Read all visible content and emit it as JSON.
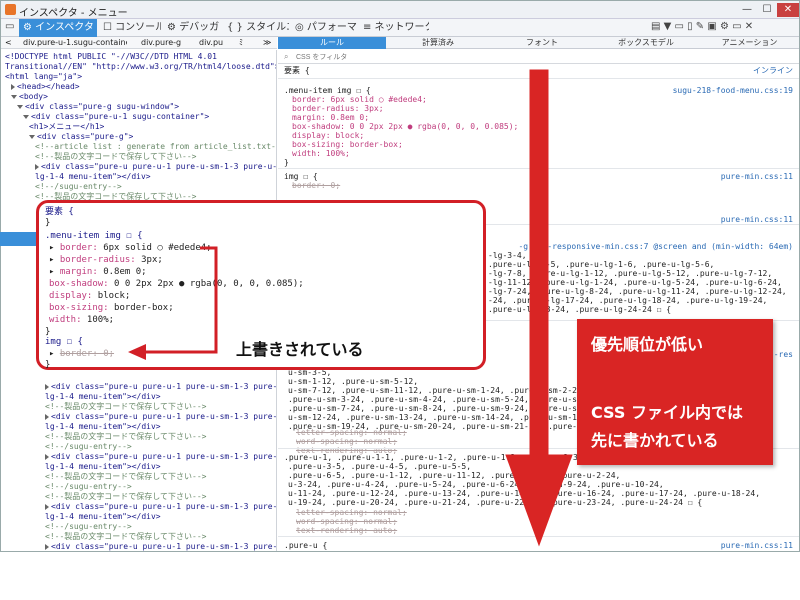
{
  "window": {
    "title": "インスペクタ - メニュー",
    "min": "—",
    "max": "☐",
    "close": "✕"
  },
  "toolbar": {
    "tabs": [
      {
        "label": "⚙ インスペクタ",
        "active": true
      },
      {
        "label": "☐ コンソール"
      },
      {
        "label": "⚙ デバッガ"
      },
      {
        "label": "{ } スタイルエ…"
      },
      {
        "label": "◎ パフォーマ…"
      },
      {
        "label": "≡ ネットワーク"
      }
    ],
    "right_icons": "▤ ▼  ▭ ▯  ✎ ▣  ⚙ ▭ ✕"
  },
  "breadcrumb": {
    "back": "<",
    "items": [
      "div.pure-u-1.sugu-container",
      "div.pure-g",
      "div.pu"
    ],
    "more": "≫",
    "more_left": "ﾐ"
  },
  "markup": {
    "lines": [
      {
        "text": "<!DOCTYPE html PUBLIC \"-//W3C//DTD HTML 4.01",
        "indent": 0
      },
      {
        "text": "Transitional//EN\" \"http://www.w3.org/TR/html4/loose.dtd\">",
        "indent": 0
      },
      {
        "text": "<html lang=\"ja\">",
        "indent": 0
      },
      {
        "text": "<head></head>",
        "indent": 1,
        "tri": "r"
      },
      {
        "text": "<body>",
        "indent": 1,
        "tri": "d"
      },
      {
        "text": "<div class=\"pure-g sugu-window\">",
        "indent": 2,
        "tri": "d"
      },
      {
        "text": "<div class=\"pure-u-1 sugu-container\">",
        "indent": 3,
        "tri": "d"
      },
      {
        "text": "<h1>メニュー</h1>",
        "indent": 4
      },
      {
        "text": "<div class=\"pure-g\">",
        "indent": 4,
        "tri": "d"
      },
      {
        "text": "<!--article list : generate from article_list.txt-->",
        "indent": 5,
        "cm": true
      },
      {
        "text": "<!--製品の文字コードで保存して下さい-->",
        "indent": 5,
        "cm": true
      },
      {
        "text": "<div class=\"pure-u pure-u-1 pure-u-sm-1-3 pure-u-",
        "indent": 5,
        "tri": "r"
      },
      {
        "text": "lg-1-4 menu-item\"></div>",
        "indent": 5
      },
      {
        "text": "<!--/sugu-entry-->",
        "indent": 5,
        "cm": true
      },
      {
        "text": "<!--製品の文字コードで保存して下さい-->",
        "indent": 5,
        "cm": true
      }
    ],
    "lines2": [
      {
        "text": "<div class=\"pure-u pure-u-1 pure-u-sm-1-3 pure-u-",
        "tri": "r"
      },
      {
        "text": "lg-1-4 menu-item\"></div>"
      },
      {
        "text": "<!--製品の文字コードで保存して下さい-->",
        "cm": true
      },
      {
        "text": "<div class=\"pure-u pure-u-1 pure-u-sm-1-3 pure-u-",
        "tri": "r"
      },
      {
        "text": "lg-1-4 menu-item\"></div>"
      },
      {
        "text": "<!--製品の文字コードで保存して下さい-->",
        "cm": true
      },
      {
        "text": "<!--/sugu-entry-->",
        "cm": true
      },
      {
        "text": "<div class=\"pure-u pure-u-1 pure-u-sm-1-3 pure-u-",
        "tri": "r"
      },
      {
        "text": "lg-1-4 menu-item\"></div>"
      },
      {
        "text": "<!--製品の文字コードで保存して下さい-->",
        "cm": true
      },
      {
        "text": "<!--/sugu-entry-->",
        "cm": true
      },
      {
        "text": "<!--製品の文字コードで保存して下さい-->",
        "cm": true
      },
      {
        "text": "<div class=\"pure-u pure-u-1 pure-u-sm-1-3 pure-u-",
        "tri": "r"
      },
      {
        "text": "lg-1-4 menu-item\"></div>"
      },
      {
        "text": "<!--/sugu-entry-->",
        "cm": true
      },
      {
        "text": "<!--製品の文字コードで保存して下さい-->",
        "cm": true
      },
      {
        "text": "<div class=\"pure-u pure-u-1 pure-u-sm-1-3 pure-u-",
        "tri": "r"
      },
      {
        "text": "lg-1-4 menu-item\"></div>"
      },
      {
        "text": "<!--/sugu-entry-->",
        "cm": true
      },
      {
        "text": "<!--製品の文字コードで保存して下さい-->",
        "cm": true
      }
    ]
  },
  "rule_tabs": [
    "ルール",
    "計算済み",
    "フォント",
    "ボックスモデル",
    "アニメーション"
  ],
  "filter": {
    "placeholder": "CSS をフィルタ"
  },
  "rules": {
    "element_selector": "要素 {",
    "element_source": "インライン",
    "menu_item": {
      "selector": ".menu-item img ☐ {",
      "source": "sugu-218-food-menu.css:19",
      "props": [
        "border: 6px solid ○ #edede4;",
        "border-radius: 3px;",
        "margin: 0.8em 0;",
        "box-shadow: 0 0 2px 2px ● rgba(0, 0, 0, 0.085);",
        "display: block;",
        "box-sizing: border-box;",
        "width: 100%;"
      ]
    },
    "img_rule": {
      "selector": "img ☐ {",
      "source": "pure-min.css:11",
      "prop": "border: 0;"
    },
    "mid_source_1": "pure-min.css:11",
    "mid_source_2": "-grids-responsive-min.css:7 @screen and (min-width: 64em)",
    "mid_source_3": "-grids-res",
    "grid_lines_1": [
      "-lg-3-4,",
      ".pure-u-lg-1-5, .pure-u-lg-1-6, .pure-u-lg-5-6,",
      "-lg-7-8, .pure-u-lg-1-12, .pure-u-lg-5-12, .pure-u-lg-7-12,",
      "-lg-11-12, .pure-u-lg-1-24, .pure-u-lg-5-24, .pure-u-lg-6-24,",
      "-lg-7-24, .pure-u-lg-8-24, .pure-u-lg-11-24, .pure-u-lg-12-24,",
      "-24, .pure-u-lg-17-24, .pure-u-lg-18-24, .pure-u-lg-19-24,",
      ".pure-u-lg-23-24, .pure-u-lg-24-24 ☐ {"
    ],
    "grid_lines_2": [
      "u-sm-3-5,",
      "u-sm-1-12, .pure-u-sm-5-12,",
      "u-sm-7-12, .pure-u-sm-11-12, .pure-u-sm-1-24, .pure-u-sm-2-24,",
      ".pure-u-sm-3-24, .pure-u-sm-4-24, .pure-u-sm-5-24, .pure-u-sm-6-24,",
      ".pure-u-sm-7-24, .pure-u-sm-8-24, .pure-u-sm-9-24, .pure-u-sm-10-24,",
      "u-sm-12-24, .pure-u-sm-13-24, .pure-u-sm-14-24, .pure-u-sm-15-24,",
      ".pure-u-sm-19-24, .pure-u-sm-20-24, .pure-u-sm-21-24, .pure-u-sm-22-24 ☐"
    ],
    "strike_props_1": [
      "letter-spacing: normal;",
      "word-spacing: normal;",
      "text-rendering: auto;"
    ],
    "pure_u_1": ".pure-u-1, .pure-u-1-1, .pure-u-1-2, .pure-u-1-3, .pure-u-2-3,",
    "pure_u_lines": [
      ".pure-u-3-5, .pure-u-4-5, .pure-u-5-5,",
      ".pure-u-6-5, .pure-u-1-12, .pure-u-11-12, .pure-u-1-24, .pure-u-2-24,",
      "u-3-24, .pure-u-4-24, .pure-u-5-24, .pure-u-6-24, .pure-u-9-24, .pure-u-10-24,",
      "u-11-24, .pure-u-12-24, .pure-u-13-24, .pure-u-14-24, .pure-u-16-24, .pure-u-17-24, .pure-u-18-24,",
      "u-19-24, .pure-u-20-24, .pure-u-21-24, .pure-u-22-24, .pure-u-23-24, .pure-u-24-24 ☐ {"
    ],
    "strike_props_2": [
      "letter-spacing: normal;",
      "word-spacing: normal;",
      "text-rendering: auto;"
    ],
    "last_selector": ".pure-u {",
    "last_source": "pure-min.css:11"
  },
  "callout": {
    "element_open": "要素 {",
    "element_close": "}",
    "selector": ".menu-item img ☐ {",
    "props": [
      {
        "name": "border:",
        "value": " 6px solid ○ #edede4;",
        "tri": true
      },
      {
        "name": "border-radius:",
        "value": " 3px;",
        "tri": true
      },
      {
        "name": "margin:",
        "value": " 0.8em 0;",
        "tri": true
      },
      {
        "name": "box-shadow:",
        "value": " 0 0 2px 2px ● rgba(0, 0, 0, 0.085);"
      },
      {
        "name": "display:",
        "value": " block;"
      },
      {
        "name": "box-sizing:",
        "value": " border-box;"
      },
      {
        "name": "width:",
        "value": " 100%;"
      }
    ],
    "close": "}",
    "img_selector": "img ☐ {",
    "img_prop": "border: 0;",
    "img_close": "}"
  },
  "annotations": {
    "overwritten": "上書きされている",
    "low_priority": "優先順位が低い",
    "css_file_line1": "CSS ファイル内では",
    "css_file_line2": "先に書かれている"
  },
  "colors": {
    "accent_blue": "#3a8fd9",
    "red": "#d21f26",
    "note_red": "#d92524"
  }
}
